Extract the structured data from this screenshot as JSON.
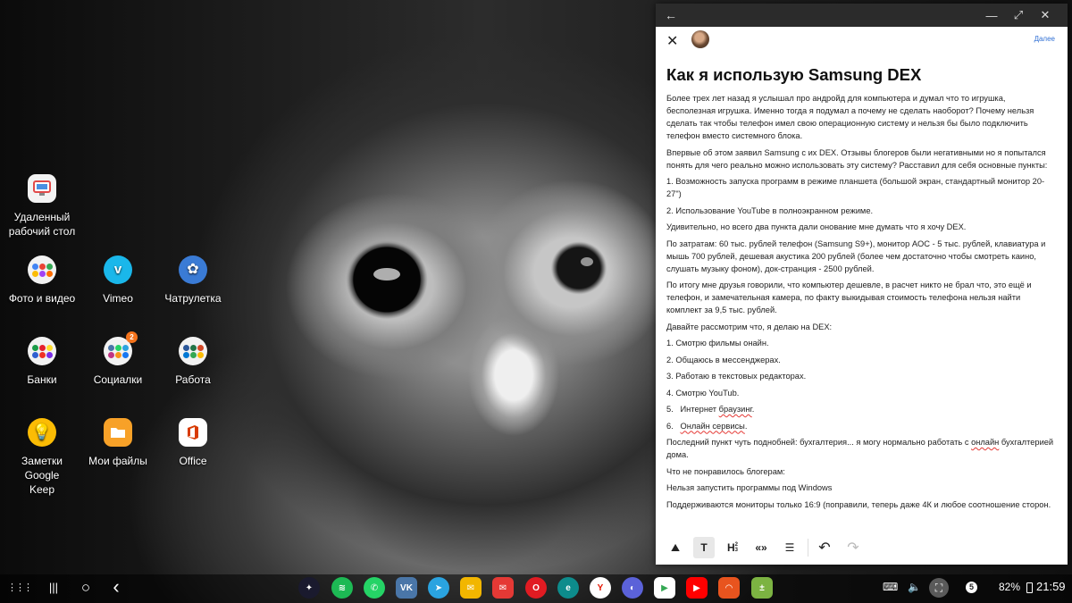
{
  "desktop": {
    "icons": [
      {
        "label": "Удаленный рабочий стол"
      },
      {
        "label": "Фото и видео"
      },
      {
        "label": "Vimeo"
      },
      {
        "label": "Чатрулетка"
      },
      {
        "label": "Банки"
      },
      {
        "label": "Социалки",
        "badge": "2"
      },
      {
        "label": "Работа"
      },
      {
        "label": "Заметки Google Keep"
      },
      {
        "label": "Мои файлы"
      },
      {
        "label": "Office"
      }
    ]
  },
  "window": {
    "back_glyph": "←",
    "minimize_glyph": "—",
    "maximize_glyph": "⤢",
    "close_glyph": "✕"
  },
  "editor": {
    "close_glyph": "✕",
    "next_label": "Далее",
    "title": "Как я использую Samsung DEX",
    "paragraphs": {
      "p1": "Более трех лет назад я услышал про андройд для компьютера и думал что то игрушка, бесполезная игрушка. Именно тогда я подумал а почему не сделать наоборот? Почему нельзя сделать так чтобы телефон имел свою операционную систему и нельзя бы было подключить телефон вместо системного блока.",
      "p2": "Впервые об этом заявил Samsung с их DEX. Отзывы блогеров были негативными но я попытался понять для чего реально можно использовать эту систему? Расставил для себя основные пункты:",
      "p3": "1. Возможность запуска программ в режиме планшета (большой экран, стандартный монитор 20-27\")",
      "p4": "2. Использование YouTube в полноэкранном режиме.",
      "p5": "Удивительно, но всего два пункта дали онование мне думать что я хочу DEX.",
      "p6": "По затратам: 60 тыс. рублей телефон (Samsung S9+), монитор AOC - 5 тыс. рублей, клавиатура и мышь 700 рублей, дешевая акустика 200 рублей (более чем достаточно чтобы смотреть каино, слушать музыку фоном), док-странция - 2500 рублей.",
      "p7": "По итогу мне друзья говорили, что компьютер дешевле, в расчет никто не брал что, это ещё и телефон, и замечательная камера, по факту выкидывая стоимость телефона нельзя найти комплект за 9,5 тыс. рублей.",
      "p8": "Давайте рассмотрим что, я делаю на DEX:",
      "list": {
        "i1": "1.   Смотрю фильмы онайн.",
        "i2": "2.   Общаюсь в мессенджерах.",
        "i3": "3.   Работаю в текстовых редакторах.",
        "i4": "4.   Смотрю YouTub.",
        "i5_pre": "5.   Интернет ",
        "i5_word": "браузинг",
        "i5_post": ".",
        "i6_pre": "6.   ",
        "i6_word": "Онлайн сервисы",
        "i6_post": "."
      },
      "p9_pre": "Последний пункт чуть поднобней: бухгалтерия... я могу нормально работать с ",
      "p9_word": "онлайн",
      "p9_post": " бухгалтерией дома.",
      "p10": "Что не понравилось блогерам:",
      "p11": "Нельзя запустить программы под Windows",
      "p12": "Поддерживаются мониторы только 16:9 (поправили, теперь даже 4К и любое соотношение сторон."
    },
    "toolbar": {
      "image_glyph": "⛰",
      "text_label": "T",
      "heading_label": "H",
      "heading_sup": "2",
      "heading_sub": "3",
      "quote_label": "«»",
      "list_glyph": "☰",
      "undo_glyph": "↶",
      "redo_glyph": "↷"
    }
  },
  "taskbar": {
    "apps_glyph": "⋮⋮⋮",
    "recents_glyph": "|||",
    "home_glyph": "○",
    "back_glyph": "‹",
    "apps": [
      {
        "name": "bixby",
        "glyph": "✦",
        "color": "#1a1a2e"
      },
      {
        "name": "spotify",
        "glyph": "≋",
        "color": "#1db954"
      },
      {
        "name": "whatsapp",
        "glyph": "✆",
        "color": "#25d366"
      },
      {
        "name": "vk",
        "glyph": "VK",
        "color": "#4a76a8"
      },
      {
        "name": "telegram",
        "glyph": "➤",
        "color": "#2aa3e0"
      },
      {
        "name": "email",
        "glyph": "✉",
        "color": "#f2b600"
      },
      {
        "name": "gmail",
        "glyph": "✉",
        "color": "#e53935"
      },
      {
        "name": "opera",
        "glyph": "O",
        "color": "#e11b22"
      },
      {
        "name": "edge",
        "glyph": "e",
        "color": "#0d8c8c"
      },
      {
        "name": "yandex",
        "glyph": "Y",
        "color": "#ffffff"
      },
      {
        "name": "messages",
        "glyph": "◐",
        "color": "#5b62d9"
      },
      {
        "name": "play-store",
        "glyph": "▶",
        "color": "#ffffff"
      },
      {
        "name": "youtube",
        "glyph": "▶",
        "color": "#ff0000"
      },
      {
        "name": "aliexpress",
        "glyph": "◠",
        "color": "#e8541e"
      },
      {
        "name": "calculator",
        "glyph": "±",
        "color": "#7cb342"
      }
    ],
    "tray": {
      "keyboard_glyph": "⌨",
      "volume_glyph": "🔈",
      "capture_glyph": "⛶",
      "notif_count": "5",
      "battery": "82%",
      "time": "21:59"
    }
  }
}
